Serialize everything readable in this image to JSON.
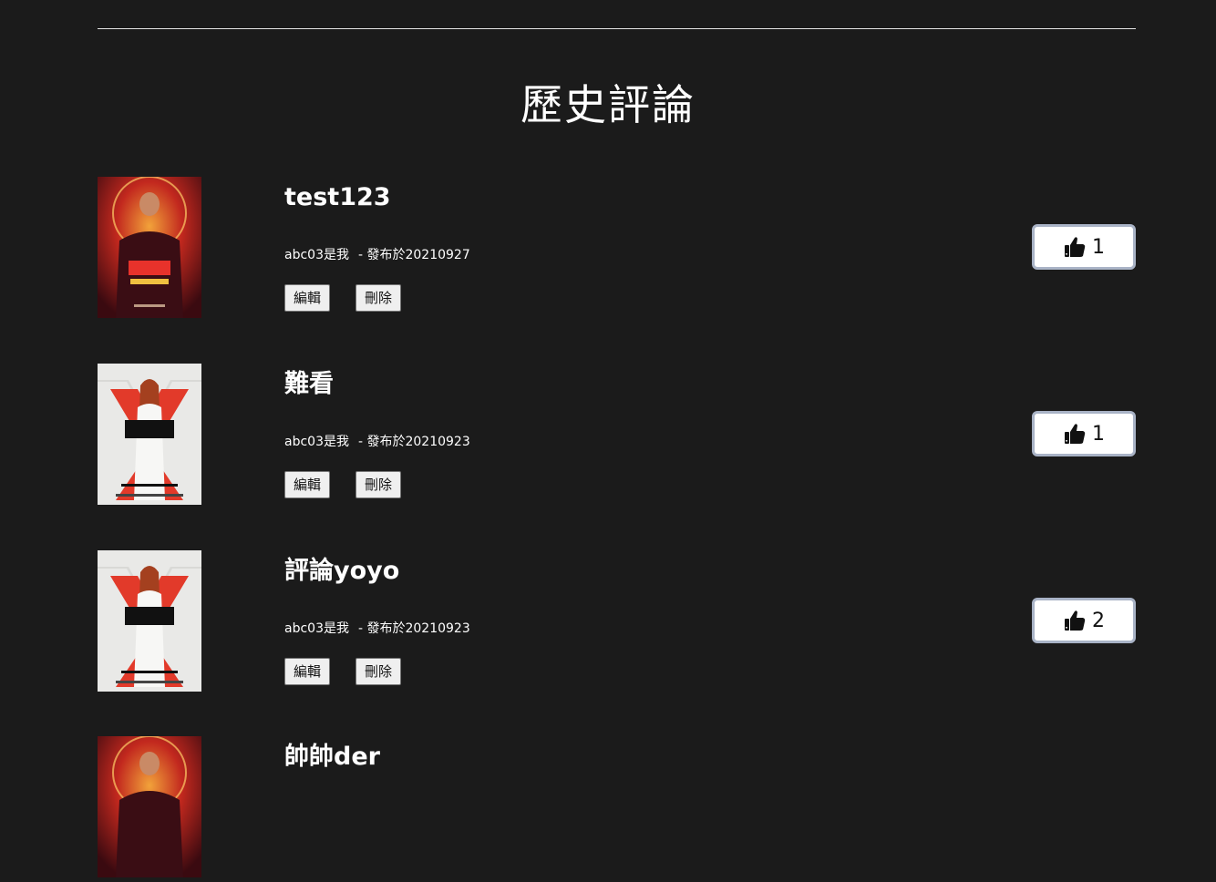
{
  "page": {
    "title": "歷史評論"
  },
  "colors": {
    "background": "#1b1b1b",
    "like_border": "#a9b3c6"
  },
  "reviews": [
    {
      "title": "test123",
      "author": "abc03是我",
      "published": "- 發布於20210927",
      "edit_label": "編輯",
      "delete_label": "刪除",
      "likes": "1",
      "poster": "shang-chi-poster"
    },
    {
      "title": "難看",
      "author": "abc03是我",
      "published": "- 發布於20210923",
      "edit_label": "編輯",
      "delete_label": "刪除",
      "likes": "1",
      "poster": "black-widow-poster"
    },
    {
      "title": "評論yoyo",
      "author": "abc03是我",
      "published": "- 發布於20210923",
      "edit_label": "編輯",
      "delete_label": "刪除",
      "likes": "2",
      "poster": "black-widow-poster"
    },
    {
      "title": "帥帥der",
      "poster": "shang-chi-poster"
    }
  ],
  "icons": {
    "like": "thumbs-up-icon"
  }
}
